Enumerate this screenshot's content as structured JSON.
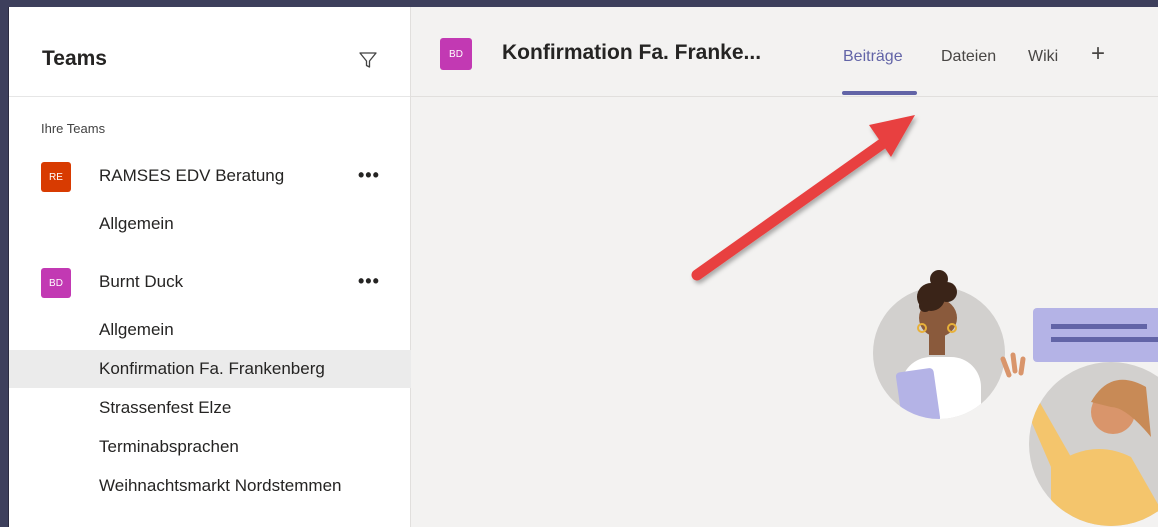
{
  "sidebar": {
    "title": "Teams",
    "section_label": "Ihre Teams",
    "teams": [
      {
        "initials": "RE",
        "name": "RAMSES EDV Beratung",
        "color": "#d83b01",
        "more": "•••",
        "channels": [
          "Allgemein"
        ]
      },
      {
        "initials": "BD",
        "name": "Burnt Duck",
        "color": "#c239b3",
        "more": "•••",
        "channels": [
          "Allgemein",
          "Konfirmation Fa. Frankenberg",
          "Strassenfest Elze",
          "Terminabsprachen",
          "Weihnachtsmarkt Nordstemmen"
        ]
      }
    ]
  },
  "main": {
    "avatar_initials": "BD",
    "title": "Konfirmation Fa. Franke...",
    "tabs": [
      {
        "label": "Beiträge",
        "active": true
      },
      {
        "label": "Dateien",
        "active": false
      },
      {
        "label": "Wiki",
        "active": false
      }
    ],
    "add_tab": "+"
  },
  "colors": {
    "accent": "#6264a7",
    "arrow": "#e8413f"
  }
}
